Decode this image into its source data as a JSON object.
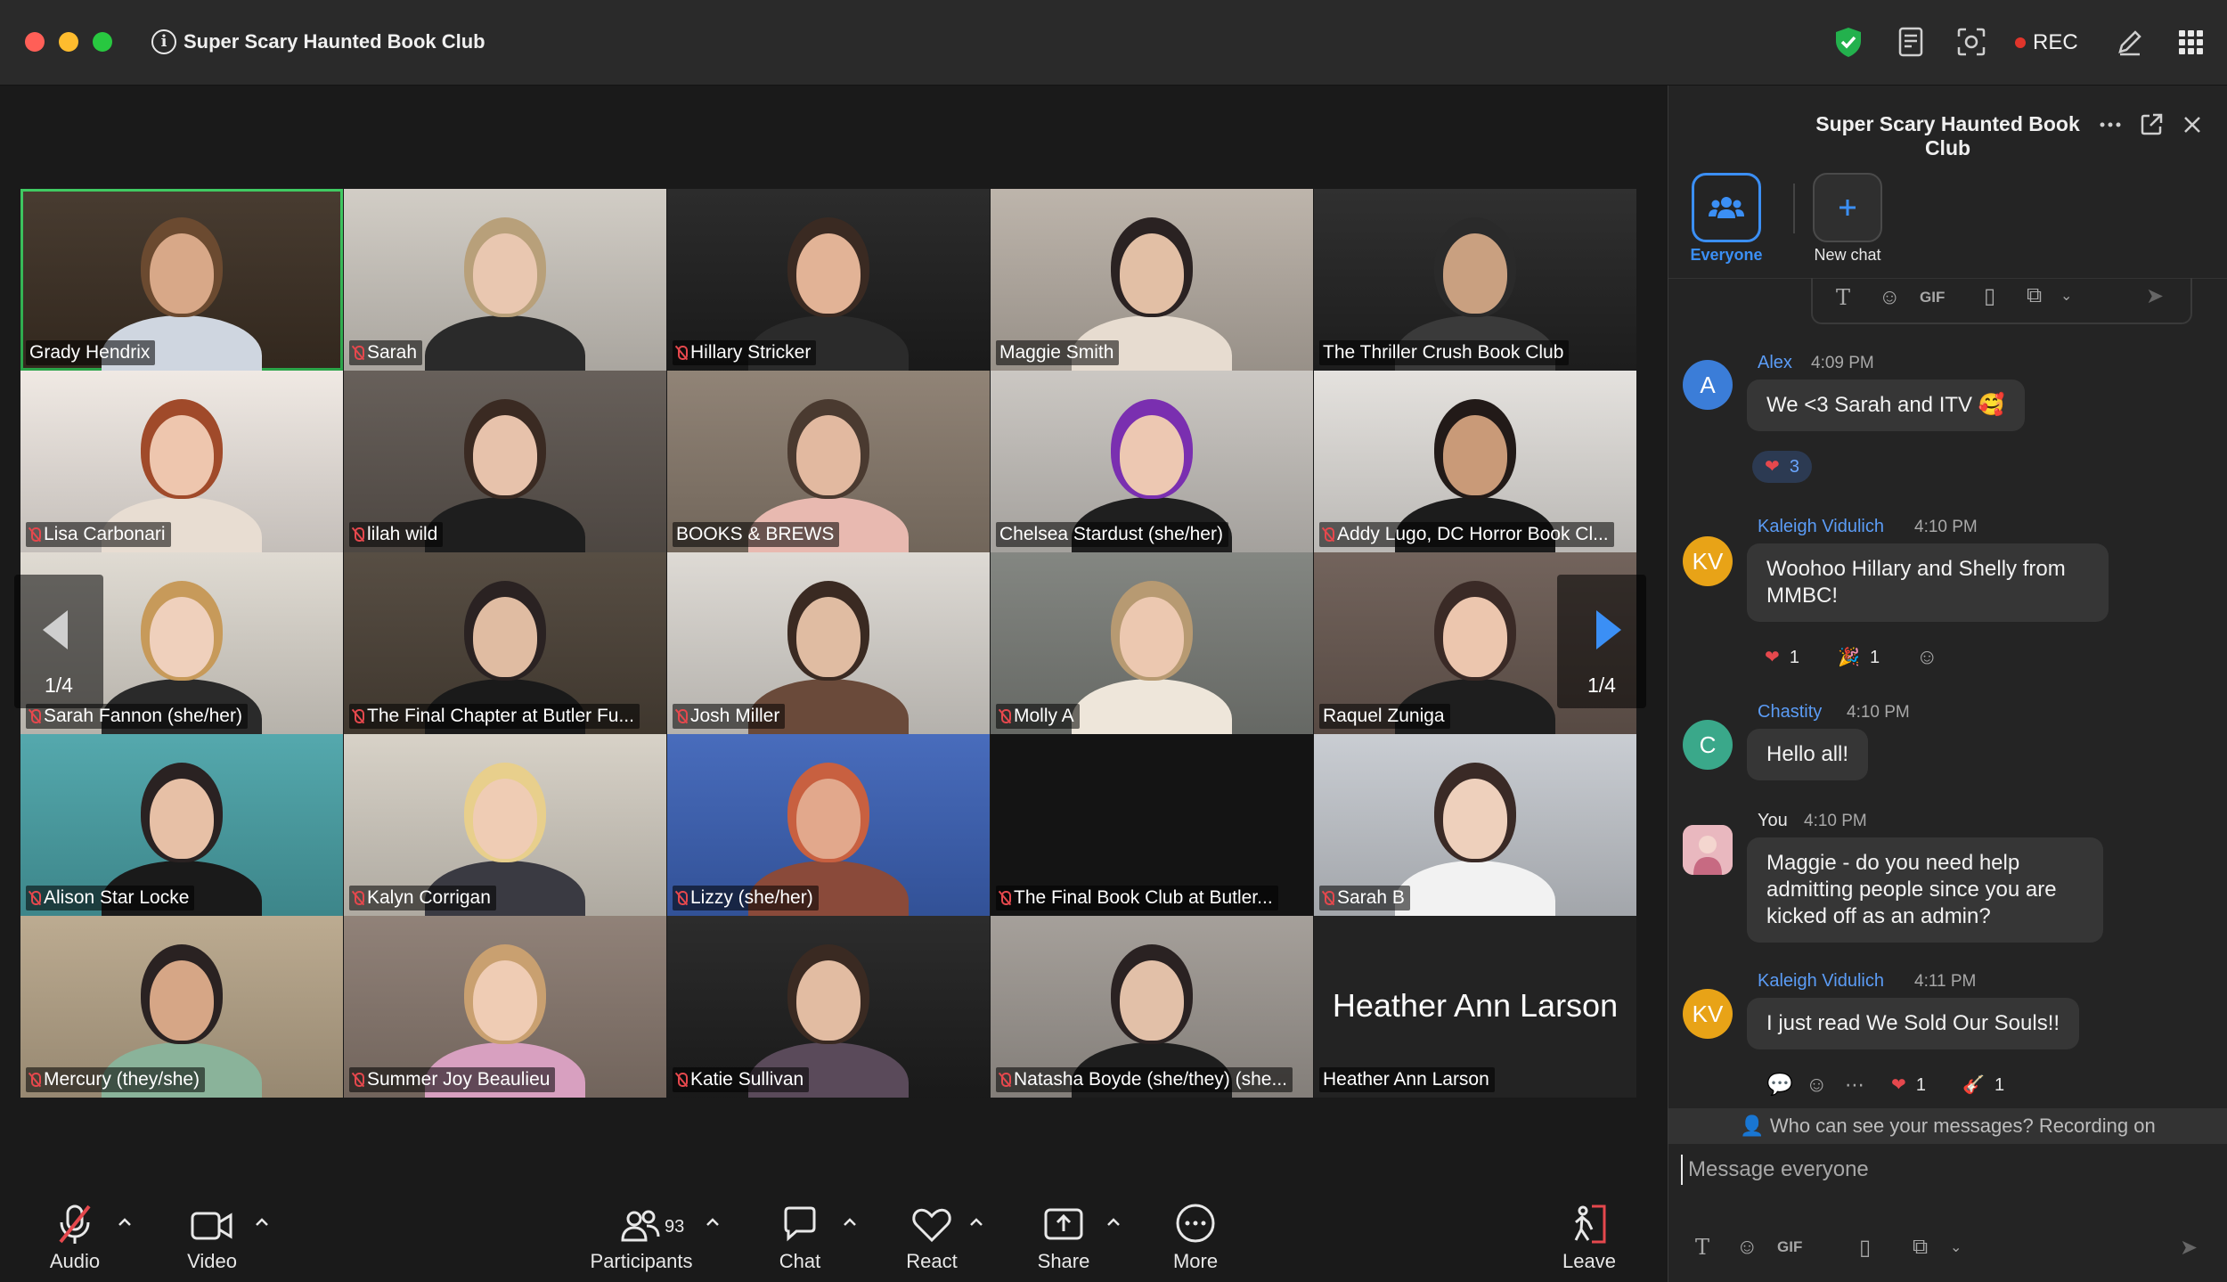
{
  "window": {
    "title": "Super Scary Haunted Book Club",
    "rec_label": "REC"
  },
  "participants": [
    {
      "name": "Grady Hendrix",
      "muted": false,
      "active": true,
      "bg": "#3d3024",
      "skin": "#d8a888",
      "hair": "#6b4a30",
      "shirt": "#cfd6e0"
    },
    {
      "name": "Sarah",
      "muted": true,
      "bg": "#cfcac2",
      "skin": "#e9c7b0",
      "hair": "#b8a07a",
      "shirt": "#2a2a2a"
    },
    {
      "name": "Hillary Stricker",
      "muted": true,
      "bg": "#1f1f1f",
      "skin": "#e2b396",
      "hair": "#3a2a22",
      "shirt": "#2b2b2b"
    },
    {
      "name": "Maggie Smith",
      "muted": false,
      "bg": "#b9b0a6",
      "skin": "#e2bfa5",
      "hair": "#2a2222",
      "shirt": "#e7dcd0"
    },
    {
      "name": "The Thriller Crush Book Club",
      "muted": false,
      "bg": "#232323",
      "skin": "#c9a080",
      "hair": "#2a2a2a",
      "shirt": "#3a3a3a"
    },
    {
      "name": "Lisa Carbonari",
      "muted": true,
      "bg": "#efe8e2",
      "skin": "#eec6ae",
      "hair": "#a04a2a",
      "shirt": "#e8ddd2"
    },
    {
      "name": "lilah wild",
      "muted": true,
      "bg": "#5e5650",
      "skin": "#e7c2ab",
      "hair": "#3a2a22",
      "shirt": "#1e1e1e"
    },
    {
      "name": "BOOKS & BREWS",
      "muted": false,
      "bg": "#8a7c6e",
      "skin": "#e2b9a0",
      "hair": "#4a3a30",
      "shirt": "#e8b9b0"
    },
    {
      "name": "Chelsea Stardust (she/her)",
      "muted": false,
      "bg": "#c8c4bf",
      "skin": "#edc8b2",
      "hair": "#7a2fb0",
      "shirt": "#1f1f1f"
    },
    {
      "name": "Addy Lugo, DC Horror Book Cl...",
      "muted": true,
      "bg": "#e3e0dc",
      "skin": "#c99a78",
      "hair": "#221a18",
      "shirt": "#1c1c1c"
    },
    {
      "name": "Sarah Fannon (she/her)",
      "muted": true,
      "bg": "#ded9d0",
      "skin": "#efd0bc",
      "hair": "#c79a5a",
      "shirt": "#2a2a2a"
    },
    {
      "name": "The Final Chapter at Butler Fu...",
      "muted": true,
      "bg": "#4d4338",
      "skin": "#e0bca2",
      "hair": "#2a2222",
      "shirt": "#1a1a1a"
    },
    {
      "name": "Josh Miller",
      "muted": true,
      "bg": "#dcd8d2",
      "skin": "#e0bca2",
      "hair": "#3a2a22",
      "shirt": "#6a4a3a"
    },
    {
      "name": "Molly A",
      "muted": true,
      "bg": "#7c7f7a",
      "skin": "#ecc8b0",
      "hair": "#b79a72",
      "shirt": "#eee6da"
    },
    {
      "name": "Raquel Zuniga",
      "muted": false,
      "bg": "#6a5a52",
      "skin": "#ecc6ae",
      "hair": "#3a2a26",
      "shirt": "#1e1e1e"
    },
    {
      "name": "Alison Star Locke",
      "muted": true,
      "bg": "#4aa3a8",
      "skin": "#e7c0a6",
      "hair": "#2a2222",
      "shirt": "#1a1a1a"
    },
    {
      "name": "Kalyn Corrigan",
      "muted": true,
      "bg": "#d5cfc4",
      "skin": "#efccb4",
      "hair": "#e8cf8c",
      "shirt": "#3a3a42"
    },
    {
      "name": "Lizzy (she/her)",
      "muted": true,
      "bg": "#3d63b8",
      "skin": "#e2a88c",
      "hair": "#c86040",
      "shirt": "#8a4a3a"
    },
    {
      "name": "The Final Book Club at Butler...",
      "muted": true,
      "bg": "#141414",
      "skin": "#141414",
      "hair": "#141414",
      "shirt": "#141414",
      "no_video": true
    },
    {
      "name": "Sarah B",
      "muted": true,
      "bg": "#c6cad0",
      "skin": "#eed0bc",
      "hair": "#3a2a26",
      "shirt": "#f2f2f2"
    },
    {
      "name": "Mercury (they/she)",
      "muted": true,
      "bg": "#b8a68a",
      "skin": "#d6a686",
      "hair": "#2a2222",
      "shirt": "#8ab39a"
    },
    {
      "name": "Summer Joy Beaulieu",
      "muted": true,
      "bg": "#8a7a70",
      "skin": "#efccb4",
      "hair": "#c9a070",
      "shirt": "#d8a0c0"
    },
    {
      "name": "Katie Sullivan",
      "muted": true,
      "bg": "#1f1f1f",
      "skin": "#e2bca2",
      "hair": "#3a2a22",
      "shirt": "#5a4a5a"
    },
    {
      "name": "Natasha Boyde (she/they) (she...",
      "muted": true,
      "bg": "#a09a94",
      "skin": "#e2c0a8",
      "hair": "#2a2222",
      "shirt": "#1e1e1e"
    },
    {
      "name": "Heather Ann Larson",
      "muted": false,
      "bg": "#232323",
      "no_video": true,
      "big_name": "Heather Ann Larson"
    }
  ],
  "grid_nav": {
    "left_page": "1/4",
    "right_page": "1/4"
  },
  "toolbar": {
    "audio": "Audio",
    "video": "Video",
    "participants": "Participants",
    "participant_count": "93",
    "chat": "Chat",
    "react": "React",
    "share": "Share",
    "more": "More",
    "leave": "Leave"
  },
  "chat": {
    "title": "Super Scary Haunted Book Club",
    "targets": {
      "everyone": "Everyone",
      "new_chat": "New chat"
    },
    "messages": [
      {
        "sender": "Alex",
        "time": "4:09 PM",
        "text": "We <3 Sarah and ITV 🥰",
        "avatar": "A",
        "avatar_color": "#3b7dd8",
        "reactions": [
          {
            "emoji": "❤",
            "count": "3"
          }
        ]
      },
      {
        "sender": "Kaleigh Vidulich",
        "time": "4:10 PM",
        "text": "Woohoo Hillary and Shelly from MMBC!",
        "avatar": "KV",
        "avatar_color": "#e8a317",
        "reactions": [
          {
            "emoji": "❤",
            "count": "1"
          },
          {
            "emoji": "🎉",
            "count": "1"
          }
        ]
      },
      {
        "sender": "Chastity",
        "time": "4:10 PM",
        "text": "Hello all!",
        "avatar": "C",
        "avatar_color": "#3aa88a"
      },
      {
        "sender": "You",
        "time": "4:10 PM",
        "text": "Maggie - do you need help admitting people since you are kicked off as an admin?",
        "avatar": "",
        "avatar_color": "#d9a0a8"
      },
      {
        "sender": "Kaleigh Vidulich",
        "time": "4:11 PM",
        "text": "I just read We Sold Our Souls!!",
        "avatar": "KV",
        "avatar_color": "#e8a317",
        "reactions": [
          {
            "emoji": "❤",
            "count": "1"
          },
          {
            "emoji": "🎸",
            "count": "1"
          }
        ]
      }
    ],
    "notice": "Who can see your messages? Recording on",
    "input_placeholder": "Message everyone",
    "format_gif": "GIF"
  }
}
